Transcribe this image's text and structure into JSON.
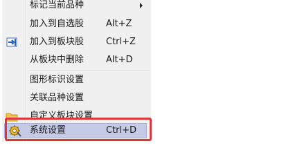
{
  "menu": {
    "items": [
      {
        "label": "标记当前品种",
        "shortcut": "",
        "submenu": true,
        "icon": ""
      },
      {
        "label": "加入到自选股",
        "shortcut": "Alt+Z",
        "icon": ""
      },
      {
        "label": "加入到板块股",
        "shortcut": "Ctrl+Z",
        "icon": "add-to-block-icon"
      },
      {
        "label": "从板块中删除",
        "shortcut": "Alt+D",
        "icon": ""
      },
      {
        "label": "图形标识设置",
        "shortcut": "",
        "icon": ""
      },
      {
        "label": "关联品种设置",
        "shortcut": "",
        "icon": ""
      },
      {
        "label": "自定义板块设置",
        "shortcut": "",
        "icon": "folder-icon"
      },
      {
        "label": "系统设置",
        "shortcut": "Ctrl+D",
        "icon": "system-settings-icon",
        "highlighted": true
      }
    ]
  },
  "colors": {
    "highlight_bg": "#c5cae6",
    "annotation_border": "#e0343f",
    "menu_bg": "#f0f0f0"
  }
}
